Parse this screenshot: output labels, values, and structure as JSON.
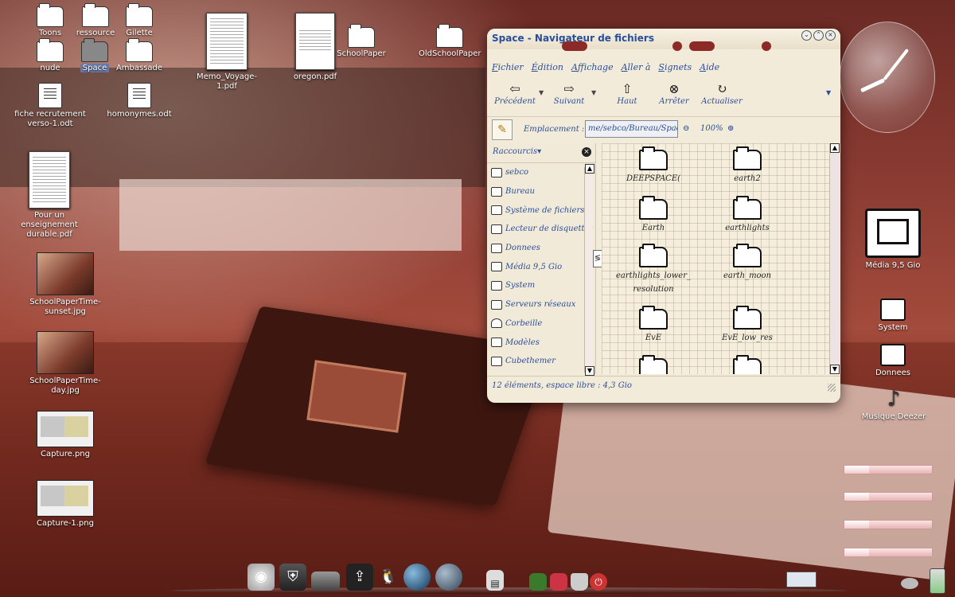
{
  "desktop_left": {
    "icons": [
      {
        "label": "Toons",
        "type": "folder"
      },
      {
        "label": "ressource",
        "type": "folder"
      },
      {
        "label": "Gilette",
        "type": "folder"
      },
      {
        "label": "nude",
        "type": "folder"
      },
      {
        "label": "Space",
        "type": "folder-selected"
      },
      {
        "label": "Ambassade",
        "type": "folder"
      },
      {
        "label": "fiche recrutement verso-1.odt",
        "type": "doc"
      },
      {
        "label": "homonymes.odt",
        "type": "doc"
      },
      {
        "label": "Memo_Voyage-1.pdf",
        "type": "pdf"
      },
      {
        "label": "oregon.pdf",
        "type": "pdf"
      },
      {
        "label": "SchoolPaper",
        "type": "folder"
      },
      {
        "label": "OldSchoolPaper",
        "type": "folder"
      },
      {
        "label": "Pour un enseignement durable.pdf",
        "type": "pdf"
      },
      {
        "label": "SchoolPaperTime-sunset.jpg",
        "type": "image"
      },
      {
        "label": "SchoolPaperTime-day.jpg",
        "type": "image"
      },
      {
        "label": "Capture.png",
        "type": "image"
      },
      {
        "label": "Capture-1.png",
        "type": "image"
      }
    ]
  },
  "desktop_right": {
    "icons": [
      {
        "label": "Média 9,5 Gio",
        "icon": "harddrive-icon"
      },
      {
        "label": "System",
        "icon": "drive-icon"
      },
      {
        "label": "Donnees",
        "icon": "drive-icon"
      },
      {
        "label": "Musique Deezer",
        "icon": "music-note-icon"
      }
    ],
    "meters": [
      {
        "value": 0.28
      },
      {
        "value": 0.28
      },
      {
        "value": 0.28
      },
      {
        "value": 0.28
      }
    ]
  },
  "window": {
    "title": "Space - Navigateur de fichiers",
    "menu": [
      "Fichier",
      "Édition",
      "Affichage",
      "Aller à",
      "Signets",
      "Aide"
    ],
    "toolbar": {
      "back": "Précédent",
      "forward": "Suivant",
      "up": "Haut",
      "stop": "Arrêter",
      "reload": "Actualiser"
    },
    "location": {
      "label": "Emplacement :",
      "path": "me/sebco/Bureau/Space",
      "zoom": "100%"
    },
    "sidebar": {
      "header": "Raccourcis",
      "items": [
        {
          "label": "sebco",
          "icon": "home-icon"
        },
        {
          "label": "Bureau",
          "icon": "desktop-icon"
        },
        {
          "label": "Système de fichiers",
          "icon": "drive-icon"
        },
        {
          "label": "Lecteur de disquettes",
          "icon": "floppy-icon"
        },
        {
          "label": "Donnees",
          "icon": "drive-icon"
        },
        {
          "label": "Média 9,5 Gio",
          "icon": "drive-icon"
        },
        {
          "label": "System",
          "icon": "drive-icon"
        },
        {
          "label": "Serveurs réseaux",
          "icon": "network-icon"
        },
        {
          "label": "Corbeille",
          "icon": "trash-icon"
        },
        {
          "label": "Modèles",
          "icon": "folder-icon"
        },
        {
          "label": "Cubethemer",
          "icon": "folder-icon"
        }
      ]
    },
    "files": [
      {
        "name": "DEEPSPACE("
      },
      {
        "name": "earth2"
      },
      {
        "name": "Earth"
      },
      {
        "name": "earthlights"
      },
      {
        "name": "earthlights_lower_\nresolution"
      },
      {
        "name": "earth_moon"
      },
      {
        "name": "EvE"
      },
      {
        "name": "EvE_low_res"
      },
      {
        "name": ""
      },
      {
        "name": ""
      }
    ],
    "status": "12 éléments, espace libre : 4,3 Gio"
  },
  "dock": {
    "items": [
      "ubuntu-icon",
      "shield-icon",
      "terminal-icon",
      "usb-icon",
      "penguin-icon",
      "globe-icon",
      "network-globe-icon",
      "printer-icon",
      "spreadsheet-icon",
      "text-editor-icon",
      "trash-icon",
      "power-icon"
    ]
  },
  "colors": {
    "accent": "#2a4f9a",
    "window_bg": "#f3ebd9",
    "rivet": "#8b2a26"
  }
}
